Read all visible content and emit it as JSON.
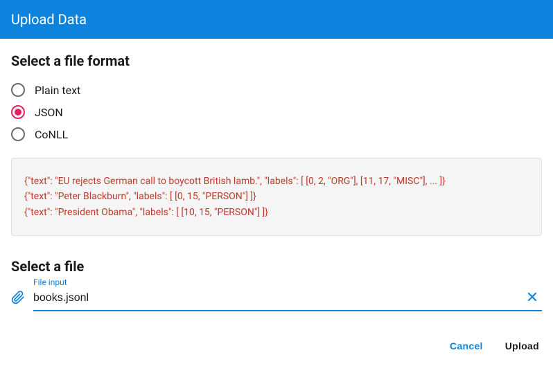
{
  "header": {
    "title": "Upload Data"
  },
  "format": {
    "title": "Select a file format",
    "options": [
      {
        "label": "Plain text",
        "selected": false
      },
      {
        "label": "JSON",
        "selected": true
      },
      {
        "label": "CoNLL",
        "selected": false
      }
    ],
    "sample": "{\"text\": \"EU rejects German call to boycott British lamb.\", \"labels\": [ [0, 2, \"ORG\"], [11, 17, \"MISC\"], ... ]}\n{\"text\": \"Peter Blackburn\", \"labels\": [ [0, 15, \"PERSON\"] ]}\n{\"text\": \"President Obama\", \"labels\": [ [10, 15, \"PERSON\"] ]}"
  },
  "file": {
    "title": "Select a file",
    "label": "File input",
    "value": "books.jsonl"
  },
  "actions": {
    "cancel": "Cancel",
    "upload": "Upload"
  }
}
